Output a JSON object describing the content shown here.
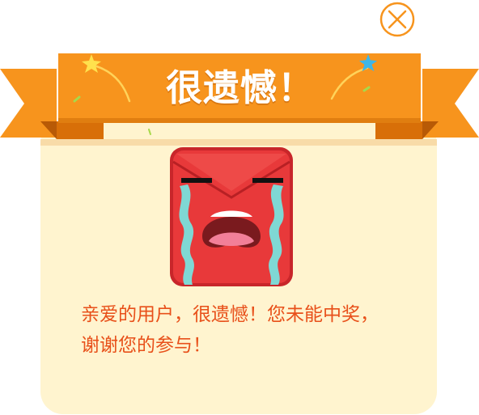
{
  "dialog": {
    "title": "很遗憾！",
    "message_line1": "亲爱的用户，很遗憾！您未能中奖，",
    "message_line2": "谢谢您的参与！"
  },
  "icons": {
    "close": "close-icon",
    "mascot": "crying-red-envelope-mascot",
    "stars": "star-sparkle-icon"
  },
  "colors": {
    "ribbon": "#f7941d",
    "ribbon_dark": "#d86f08",
    "card": "#fff4cf",
    "message": "#e8501a",
    "close": "#f7941d",
    "mascot_red": "#e8393a",
    "tears": "#7fd8d4"
  }
}
